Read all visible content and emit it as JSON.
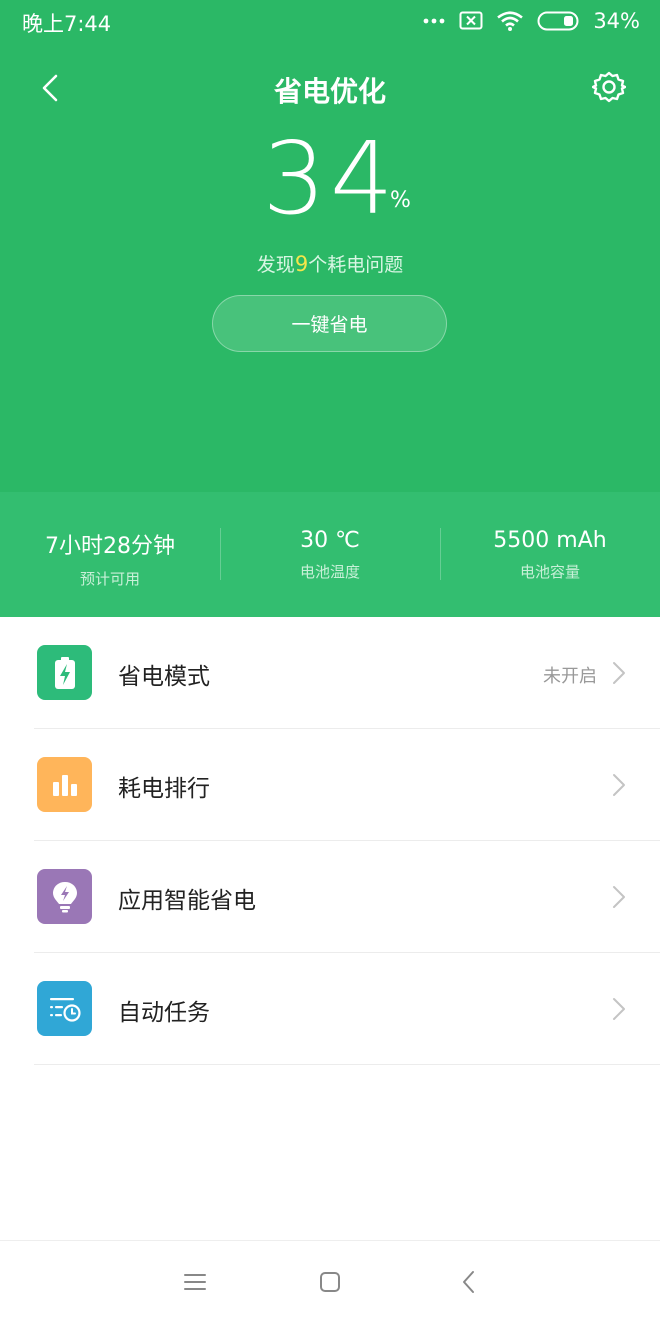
{
  "status_bar": {
    "time": "晚上7:44",
    "battery_percent": "34%",
    "icons": [
      "more-dots-icon",
      "sim-disabled-icon",
      "wifi-icon",
      "battery-icon"
    ]
  },
  "header": {
    "title": "省电优化",
    "back_icon": "back-chevron-icon",
    "settings_icon": "gear-icon"
  },
  "battery": {
    "level": "34",
    "unit": "%",
    "problems_prefix": "发现",
    "problems_count": "9",
    "problems_suffix": "个耗电问题",
    "action_label": "一键省电"
  },
  "stats": [
    {
      "value": "7小时28分钟",
      "label": "预计可用"
    },
    {
      "value": "30 ℃",
      "label": "电池温度"
    },
    {
      "value": "5500 mAh",
      "label": "电池容量"
    }
  ],
  "menu": [
    {
      "label": "省电模式",
      "value": "未开启",
      "icon": "battery-charging-icon",
      "color": "#2dbb7a"
    },
    {
      "label": "耗电排行",
      "value": "",
      "icon": "bar-chart-icon",
      "color": "#ffb55a"
    },
    {
      "label": "应用智能省电",
      "value": "",
      "icon": "lightbulb-bolt-icon",
      "color": "#9a77b6"
    },
    {
      "label": "自动任务",
      "value": "",
      "icon": "list-clock-icon",
      "color": "#30a7d6"
    }
  ],
  "colors": {
    "hero_green": "#2bb866",
    "stats_green": "#33be70",
    "highlight_yellow": "#f5e64a"
  },
  "navigation": {
    "icons": [
      "menu-icon",
      "home-icon",
      "back-icon"
    ]
  }
}
